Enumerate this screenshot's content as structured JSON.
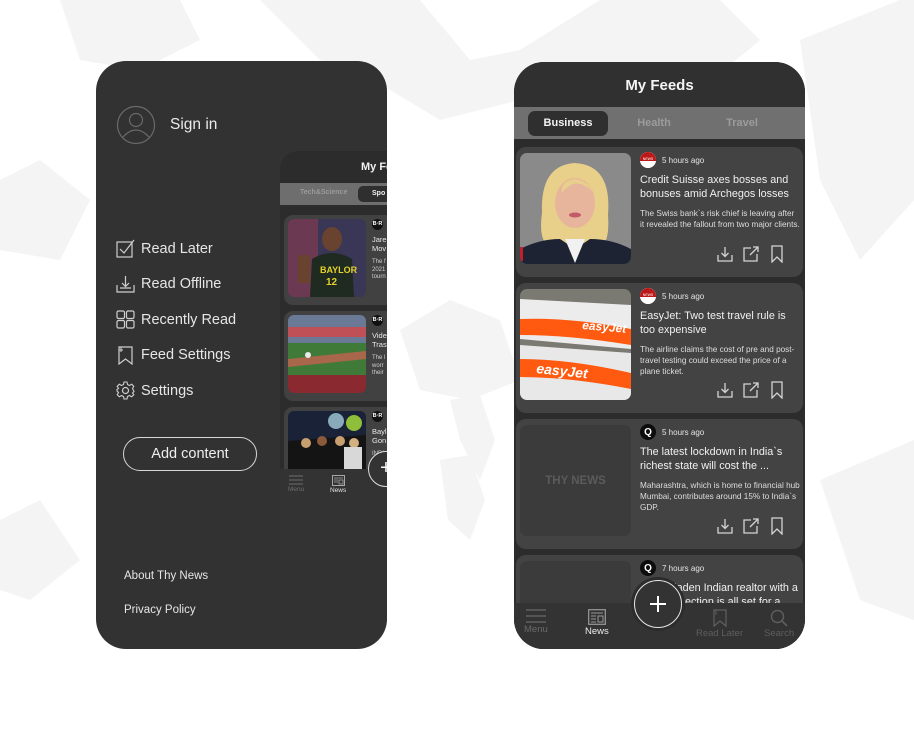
{
  "drawer": {
    "sign_in_label": "Sign in",
    "menu": [
      {
        "label": "Read Later",
        "icon": "checkbox-icon"
      },
      {
        "label": "Read Offline",
        "icon": "download-tray-icon"
      },
      {
        "label": "Recently Read",
        "icon": "grid-icon"
      },
      {
        "label": "Feed Settings",
        "icon": "bookmark-ribbon-icon"
      },
      {
        "label": "Settings",
        "icon": "gear-icon"
      }
    ],
    "add_content_label": "Add content",
    "footer": {
      "about_label": "About Thy News",
      "privacy_label": "Privacy Policy"
    }
  },
  "mini_feed": {
    "title": "My Fe",
    "tabs": [
      "Tech&Science",
      "Spo"
    ],
    "source_badge": "B·R",
    "cards": [
      {
        "title_lines": [
          "Jare",
          "Mov"
        ],
        "desc_lines": [
          "The f",
          "2021",
          "tourn"
        ]
      },
      {
        "title_lines": [
          "Vide",
          "Tras"
        ],
        "desc_lines": [
          "The l",
          "worr",
          "their"
        ]
      },
      {
        "title_lines": [
          "Bayl",
          "Gon"
        ],
        "desc_lines": [
          "INDI",
          "hour",
          "Gonz"
        ]
      },
      {
        "title_lines": [],
        "desc_lines": []
      }
    ],
    "nav": {
      "menu_label": "Menu",
      "news_label": "News"
    },
    "fab_label": "+"
  },
  "feed": {
    "header_title": "My Feeds",
    "tabs": [
      {
        "label": "Business",
        "active": true
      },
      {
        "label": "Health",
        "active": false
      },
      {
        "label": "Travel",
        "active": false
      }
    ],
    "articles": [
      {
        "source": "BBC News",
        "time": "5 hours ago",
        "title": "Credit Suisse axes bosses and bonuses amid Archegos losses",
        "description": "The Swiss bank`s risk chief is leaving after it revealed the fallout from two major clients.",
        "image": "portrait-photo"
      },
      {
        "source": "BBC News",
        "time": "5 hours ago",
        "title": "EasyJet: Two test travel rule is too expensive",
        "description": "The airline claims the cost of pre and post-travel testing could exceed the price of a plane ticket.",
        "image": "easyjet-planes-photo",
        "image_text": "easyJet"
      },
      {
        "source": "Q",
        "time": "5 hours ago",
        "title": "The latest lockdown in India`s richest state will cost the ...",
        "description": "Maharashtra, which is home to financial hub Mumbai, contributes around 15% to India`s GDP.",
        "image": "placeholder",
        "placeholder_text": "THY NEWS"
      },
      {
        "source": "Q",
        "time": "7 hours ago",
        "title": "A ...laden Indian realtor with a ...nnection is all set for a...",
        "title_line1": "A",
        "title_line1b": "laden Indian realtor with a",
        "title_line2": "nnection is all set for a...",
        "description": "",
        "image": "placeholder"
      }
    ],
    "bottom_nav": [
      {
        "label": "Menu",
        "icon": "hamburger-icon",
        "active": false
      },
      {
        "label": "News",
        "icon": "newspaper-icon",
        "active": true
      },
      {
        "label": "Read Later",
        "icon": "bookmark-ribbon-icon",
        "active": false
      },
      {
        "label": "Search",
        "icon": "search-icon",
        "active": false
      }
    ],
    "fab_label": "+"
  },
  "colors": {
    "phone_bg": "#323232",
    "card_bg": "#434343",
    "tab_bar": "#707070",
    "text": "#f0f0f0",
    "muted": "#9c9c9c",
    "bbc_red": "#bb1919"
  }
}
